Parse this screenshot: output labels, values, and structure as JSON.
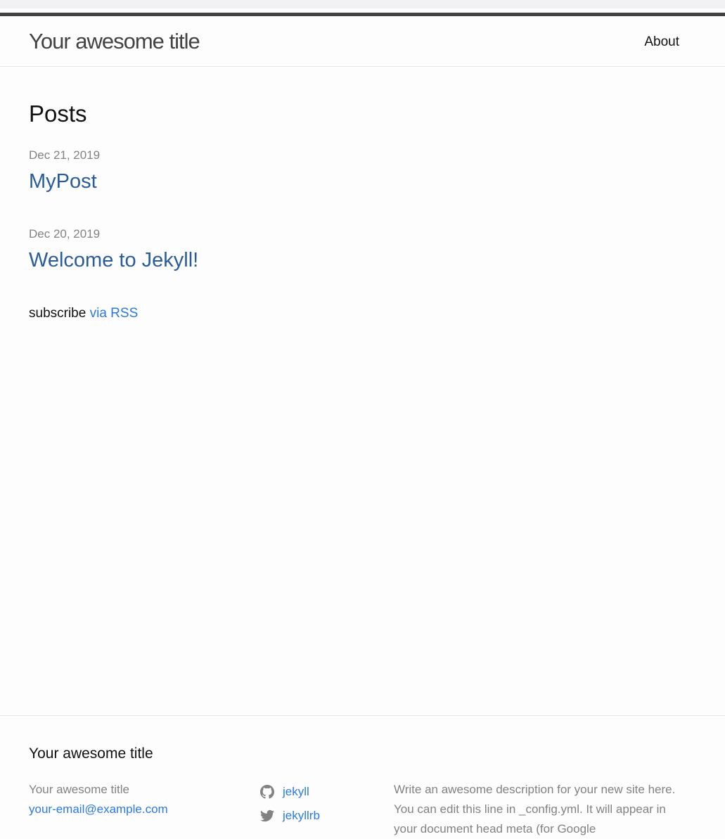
{
  "header": {
    "site_title": "Your awesome title",
    "nav": [
      {
        "label": "About"
      }
    ]
  },
  "main": {
    "heading": "Posts",
    "posts": [
      {
        "date": "Dec 21, 2019",
        "title": "MyPost"
      },
      {
        "date": "Dec 20, 2019",
        "title": "Welcome to Jekyll!"
      }
    ],
    "rss_prefix": "subscribe ",
    "rss_link": "via RSS"
  },
  "footer": {
    "heading": "Your awesome title",
    "site_name": "Your awesome title",
    "email": "your-email@example.com",
    "social": [
      {
        "icon": "github-icon",
        "label": "jekyll"
      },
      {
        "icon": "twitter-icon",
        "label": "jekyllrb"
      }
    ],
    "description": "Write an awesome description for your new site here. You can edit this line in _config.yml. It will appear in your document head meta (for Google"
  },
  "colors": {
    "link": "#2a7ae2",
    "post_link": "#2a5b9c",
    "meta": "#828282",
    "header_border": "#424242"
  }
}
